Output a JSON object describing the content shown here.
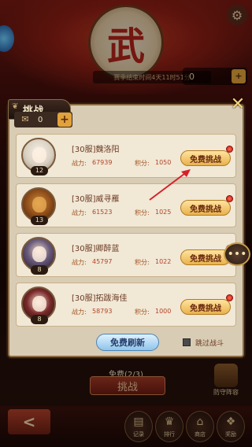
{
  "background": {
    "emblem_char": "武",
    "season_text": "赛季结束时间4天11时51分",
    "currency_value": "0",
    "plus_glyph": "+"
  },
  "dialog": {
    "title": "挑战",
    "currency_value": "0",
    "plus_glyph": "+",
    "close_glyph": "✕",
    "opponents": [
      {
        "name": "[30服]魏洛阳",
        "level": "12",
        "power_label": "战力:",
        "power": "67939",
        "score_label": "积分:",
        "score": "1050",
        "button": "免费挑战"
      },
      {
        "name": "[30服]威寻雁",
        "level": "13",
        "power_label": "战力:",
        "power": "61523",
        "score_label": "积分:",
        "score": "1025",
        "button": "免费挑战"
      },
      {
        "name": "[30服]卿醉蓝",
        "level": "8",
        "power_label": "战力:",
        "power": "45797",
        "score_label": "积分:",
        "score": "1022",
        "button": "免费挑战"
      },
      {
        "name": "[30服]拓跋海佳",
        "level": "8",
        "power_label": "战力:",
        "power": "58793",
        "score_label": "积分:",
        "score": "1000",
        "button": "免费挑战"
      }
    ],
    "refresh_button": "免费刷新",
    "skip_label": "跳过战斗"
  },
  "bottom": {
    "free_text": "免费(2/3)",
    "challenge_button": "挑战",
    "defend_label": "防守阵容",
    "back_glyph": "<",
    "nav": [
      "记录",
      "排行",
      "商店",
      "奖励"
    ]
  },
  "colors": {
    "dialog_bg": "#d9ccb4",
    "card_bg": "#f1e8d6",
    "fight_button": "#e8b24c",
    "refresh_button": "#8fc4ea",
    "red_dot": "#c31a10",
    "pointer_arrow": "#d8202a"
  }
}
